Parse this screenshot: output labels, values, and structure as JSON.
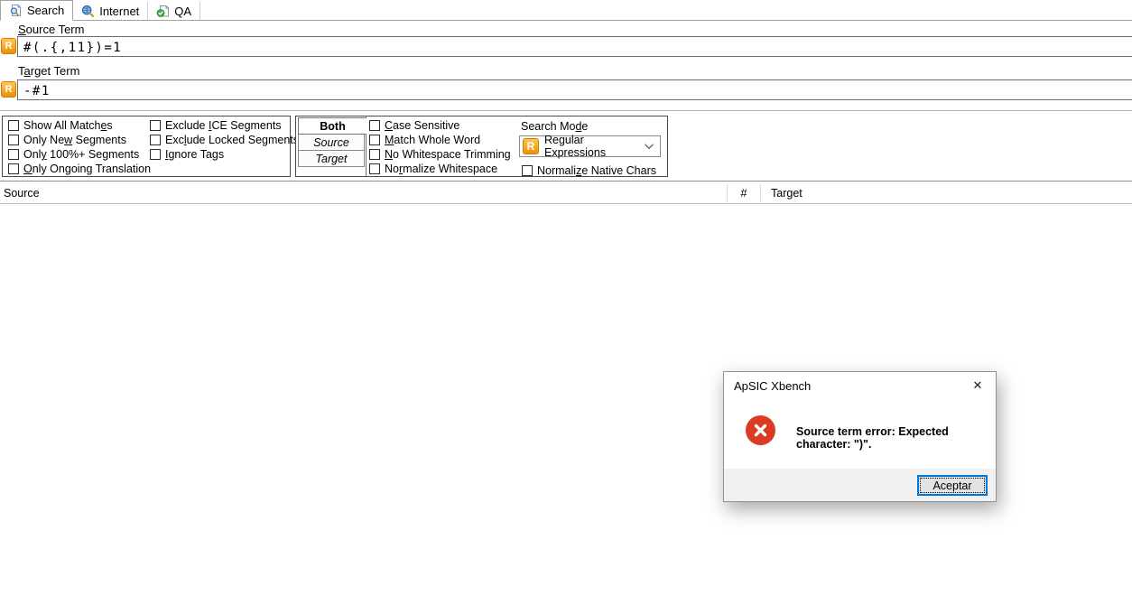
{
  "icons": {
    "regex_glyph": "R"
  },
  "tabbar": {
    "tabs": [
      {
        "label": "Search",
        "active": true
      },
      {
        "label": "Internet",
        "active": false
      },
      {
        "label": "QA",
        "active": false
      }
    ]
  },
  "search_form": {
    "source_term": {
      "label": {
        "text": "Source Term",
        "key": "S"
      },
      "value": "#(.{,11})=1"
    },
    "target_term": {
      "label": {
        "text": "Target Term",
        "key": "a"
      },
      "value": "-#1"
    }
  },
  "filters": {
    "segment_filters": [
      {
        "text": "Show All Matches",
        "key": "e",
        "checked": false
      },
      {
        "text": "Only New Segments",
        "key": "w",
        "checked": false
      },
      {
        "text": "Only 100%+ Segments",
        "key": "y",
        "checked": false
      },
      {
        "text": "Only Ongoing Translation",
        "key": "O",
        "checked": false
      }
    ],
    "exclusion_filters": [
      {
        "text": "Exclude ICE Segments",
        "key": "I",
        "checked": false
      },
      {
        "text": "Exclude Locked Segments",
        "key": "l",
        "checked": false
      },
      {
        "text": "Ignore Tags",
        "key": "I",
        "checked": false
      }
    ],
    "scope_tabs": [
      {
        "label": "Both",
        "selected": true
      },
      {
        "label": "Source",
        "selected": false
      },
      {
        "label": "Target",
        "selected": false
      }
    ],
    "match_options": [
      {
        "text": "Case Sensitive",
        "key": "C",
        "checked": false
      },
      {
        "text": "Match Whole Word",
        "key": "M",
        "checked": false
      },
      {
        "text": "No Whitespace Trimming",
        "key": "N",
        "checked": false
      },
      {
        "text": "Normalize Whitespace",
        "key": "r",
        "checked": false
      }
    ],
    "search_mode": {
      "label": {
        "text": "Search Mode",
        "key": "d"
      },
      "selected": "Regular Expressions"
    },
    "normalize_native": {
      "text": "Normalize Native Chars",
      "key": "z",
      "checked": false
    }
  },
  "results": {
    "columns": [
      {
        "label": "Source"
      },
      {
        "label": "#"
      },
      {
        "label": "Target"
      }
    ],
    "rows": []
  },
  "dialog": {
    "title": "ApSIC Xbench",
    "message": "Source term error: Expected character: \")\".",
    "ok_label": "Aceptar",
    "close_glyph": "✕"
  },
  "colors": {
    "accent_orange": "#f09008",
    "error_red": "#dc3a22",
    "focus_blue": "#0078d7"
  }
}
